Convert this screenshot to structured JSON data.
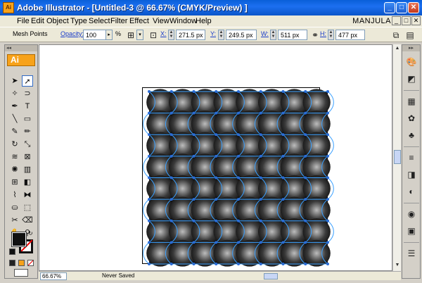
{
  "window": {
    "app_icon_text": "Ai",
    "title": "Adobe Illustrator - [Untitled-3 @ 66.67% (CMYK/Preview) ]",
    "minimize": "_",
    "maximize": "□",
    "close": "✕"
  },
  "menu": {
    "items": [
      "File",
      "Edit",
      "Object",
      "Type",
      "Select",
      "Filter",
      "Effect",
      "View",
      "Window",
      "Help"
    ],
    "user": "MANJULA",
    "doc_controls": [
      "_",
      "□",
      "✕"
    ]
  },
  "control_bar": {
    "selection_label": "Mesh Points",
    "opacity_label": "Opacity:",
    "opacity_value": "100",
    "opacity_unit": "%",
    "x_label": "X:",
    "x_value": "271.5 px",
    "y_label": "Y:",
    "y_value": "249.5 px",
    "w_label": "W:",
    "w_value": "511 px",
    "h_label": "H:",
    "h_value": "477 px"
  },
  "toolbox": {
    "logo": "Ai",
    "collapse": "◂◂"
  },
  "status_bar": {
    "zoom": "66.67%",
    "status_text": "Never Saved"
  },
  "dock": {
    "collapse": "▸▸"
  },
  "colors": {
    "titlebar": "#0a5fd8",
    "mesh_lines": "#3aa0ff",
    "mesh_points": "#2a6bd6",
    "art_dark": "#111111",
    "ai_orange": "#f7a21a"
  },
  "icons": {
    "window_close": "close-icon",
    "window_maximize": "maximize-icon",
    "window_minimize": "minimize-icon"
  }
}
